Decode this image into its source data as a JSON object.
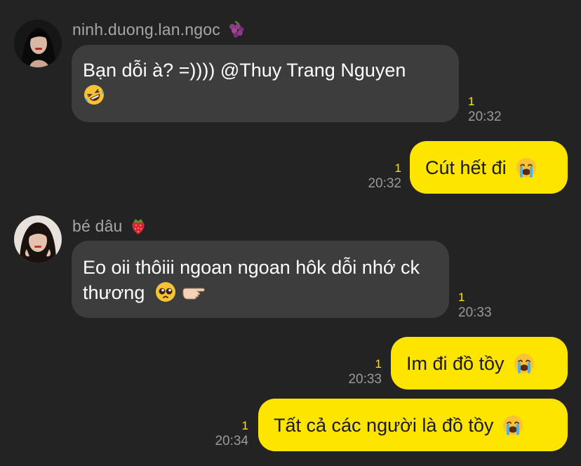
{
  "messages": [
    {
      "sender": "ninh.duong.lan.ngoc",
      "sender_emoji": "grapes-icon",
      "text": "Bạn dỗi à? =)))) @Thuy Trang Nguyen",
      "emoji": "rofl-face-icon",
      "unread": "1",
      "time": "20:32"
    },
    {
      "text": "Cút hết đi",
      "emoji": "crying-face-icon",
      "unread": "1",
      "time": "20:32"
    },
    {
      "sender": "bé dâu",
      "sender_emoji": "strawberry-icon",
      "text": "Eo oii thôiii ngoan ngoan hôk dỗi nhớ ck thương",
      "emoji": "pleading-face-icon",
      "emoji2": "pointing-hand-icon",
      "unread": "1",
      "time": "20:33"
    },
    {
      "text": "Im đi đồ tồy",
      "emoji": "crying-face-icon",
      "unread": "1",
      "time": "20:33"
    },
    {
      "text": "Tất cả các người là đồ tồy",
      "emoji": "crying-face-icon",
      "unread": "1",
      "time": "20:34"
    }
  ],
  "colors": {
    "background": "#232323",
    "incoming_bubble": "#3d3d3d",
    "outgoing_bubble": "#fee500",
    "unread": "#fee500",
    "timestamp": "#9a9a9a"
  }
}
